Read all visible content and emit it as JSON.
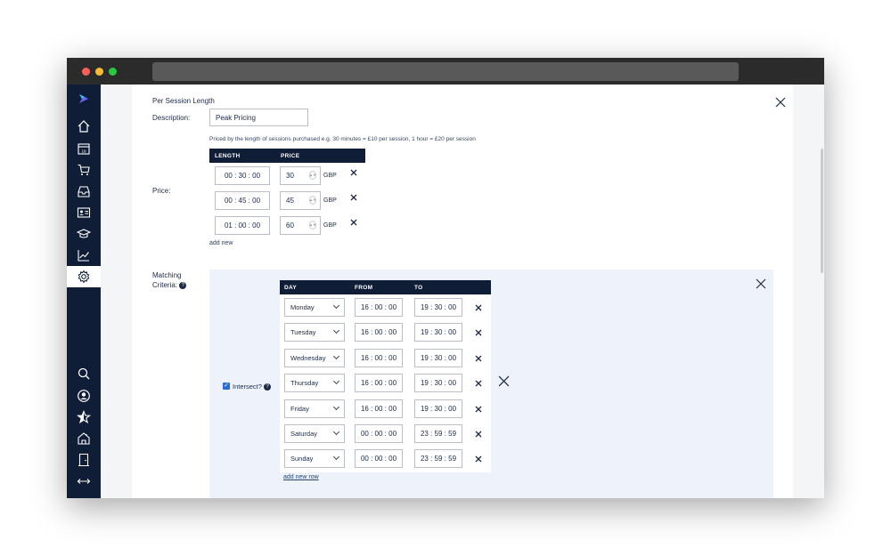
{
  "sidebar": {
    "icons": [
      "logo-icon",
      "home-icon",
      "calendar-icon",
      "cart-icon",
      "inbox-icon",
      "contact-card-icon",
      "graduation-cap-icon",
      "chart-icon",
      "settings-icon",
      "search-icon",
      "user-icon",
      "star-icon",
      "house-icon",
      "door-icon",
      "resize-icon"
    ],
    "calendar_day": "19"
  },
  "form": {
    "section_title": "Per Session Length",
    "description_label": "Description:",
    "description_value": "Peak Pricing",
    "price_label": "Price:",
    "price_hint": "Priced by the length of sessions purchased e.g. 30 minutes = £10 per session, 1 hour = £20 per session",
    "price_table": {
      "headers": [
        "LENGTH",
        "PRICE"
      ],
      "rows": [
        {
          "length": "00 : 30 : 00",
          "price": "30",
          "currency": "GBP"
        },
        {
          "length": "00 : 45 : 00",
          "price": "45",
          "currency": "GBP"
        },
        {
          "length": "01 : 00 : 00",
          "price": "60",
          "currency": "GBP"
        }
      ],
      "add_new": "add new"
    },
    "matching_label_1": "Matching",
    "matching_label_2": "Criteria:",
    "intersect_label": "Intersect?",
    "schedule": {
      "headers": [
        "DAY",
        "FROM",
        "TO"
      ],
      "rows": [
        {
          "day": "Monday",
          "from": "16 : 00 : 00",
          "to": "19 : 30 : 00"
        },
        {
          "day": "Tuesday",
          "from": "16 : 00 : 00",
          "to": "19 : 30 : 00"
        },
        {
          "day": "Wednesday",
          "from": "16 : 00 : 00",
          "to": "19 : 30 : 00"
        },
        {
          "day": "Thursday",
          "from": "16 : 00 : 00",
          "to": "19 : 30 : 00"
        },
        {
          "day": "Friday",
          "from": "16 : 00 : 00",
          "to": "19 : 30 : 00"
        },
        {
          "day": "Saturday",
          "from": "00 : 00 : 00",
          "to": "23 : 59 : 59"
        },
        {
          "day": "Sunday",
          "from": "00 : 00 : 00",
          "to": "23 : 59 : 59"
        }
      ],
      "add_new_row": "add new row"
    }
  },
  "colors": {
    "navy": "#0f1d36",
    "accent": "#2b6cd8",
    "criteria_bg": "#eef3fb"
  }
}
